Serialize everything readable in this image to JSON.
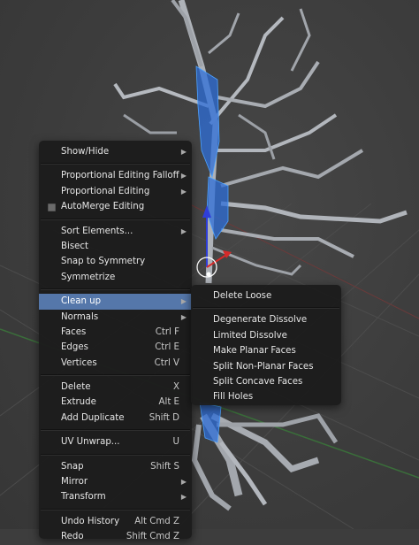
{
  "context_menu": {
    "items": [
      {
        "label": "Show/Hide",
        "submenu": true
      },
      {
        "separator": true
      },
      {
        "label": "Proportional Editing Falloff",
        "submenu": true
      },
      {
        "label": "Proportional Editing",
        "submenu": true
      },
      {
        "label": "AutoMerge Editing",
        "checkbox": true,
        "checked": false
      },
      {
        "separator": true
      },
      {
        "label": "Sort Elements...",
        "submenu": true
      },
      {
        "label": "Bisect"
      },
      {
        "label": "Snap to Symmetry"
      },
      {
        "label": "Symmetrize"
      },
      {
        "separator": true
      },
      {
        "label": "Clean up",
        "submenu": true,
        "highlighted": true
      },
      {
        "label": "Normals",
        "submenu": true
      },
      {
        "label": "Faces",
        "shortcut": "Ctrl F"
      },
      {
        "label": "Edges",
        "shortcut": "Ctrl E"
      },
      {
        "label": "Vertices",
        "shortcut": "Ctrl V"
      },
      {
        "separator": true
      },
      {
        "label": "Delete",
        "shortcut": "X"
      },
      {
        "label": "Extrude",
        "shortcut": "Alt E"
      },
      {
        "label": "Add Duplicate",
        "shortcut": "Shift D"
      },
      {
        "separator": true
      },
      {
        "label": "UV Unwrap...",
        "shortcut": "U"
      },
      {
        "separator": true
      },
      {
        "label": "Snap",
        "shortcut": "Shift S"
      },
      {
        "label": "Mirror",
        "submenu": true
      },
      {
        "label": "Transform",
        "submenu": true
      },
      {
        "separator": true
      },
      {
        "label": "Undo History",
        "shortcut": "Alt Cmd Z"
      },
      {
        "label": "Redo",
        "shortcut": "Shift Cmd Z"
      }
    ]
  },
  "cleanup_submenu": {
    "items": [
      {
        "label": "Delete Loose"
      },
      {
        "separator": true
      },
      {
        "label": "Degenerate Dissolve"
      },
      {
        "label": "Limited Dissolve"
      },
      {
        "label": "Make Planar Faces"
      },
      {
        "label": "Split Non-Planar Faces"
      },
      {
        "label": "Split Concave Faces"
      },
      {
        "label": "Fill Holes"
      }
    ]
  },
  "colors": {
    "viewport_bg": "#3d3d3d",
    "menu_bg": "#1c1c1c",
    "highlight": "#5577aa",
    "selection_blue": "#3a7bd5",
    "axis_green": "#2f6b2f",
    "gizmo_z": "#2f3ed9",
    "gizmo_x": "#d62a2a",
    "mesh_gray": "#a8acb3"
  },
  "icons": {
    "submenu_arrow": "chevron-right-icon",
    "checkbox": "checkbox-icon"
  }
}
